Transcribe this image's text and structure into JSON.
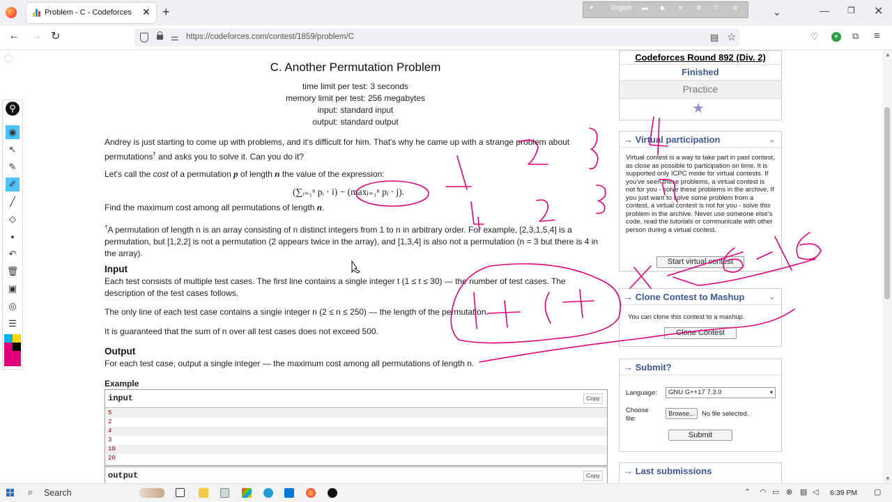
{
  "browser": {
    "tab_title": "Problem - C - Codeforces",
    "tab_close": "✕",
    "new_tab": "+",
    "tab_list": "⌄",
    "url": "https://codeforces.com/contest/1859/problem/C",
    "overlay_label": "English",
    "window": {
      "minimize": "—",
      "maximize": "❐",
      "close": "✕"
    }
  },
  "problem": {
    "title": "C. Another Permutation Problem",
    "time_limit": "time limit per test: 3 seconds",
    "memory_limit": "memory limit per test: 256 megabytes",
    "input": "input: standard input",
    "output": "output: standard output",
    "statement_1": "Andrey is just starting to come up with problems, and it's difficult for him. That's why he came up with a strange problem about permutations",
    "statement_1_end": " and asks you to solve it. Can you do it?",
    "cost_intro_a": "Let's call the ",
    "cost_word": "cost",
    "cost_intro_b": " of a permutation ",
    "cost_intro_c": " of length ",
    "cost_intro_d": " the value of the expression:",
    "formula": "(∑ᵢ₌₁ⁿ pᵢ · i) − (maxⱼ₌₁ⁿ pⱼ · j).",
    "find_max": "Find the maximum cost among all permutations of length ",
    "footnote": "A permutation of length n is an array consisting of n distinct integers from 1 to n in arbitrary order. For example, [2,3,1,5,4] is a permutation, but [1,2,2] is not a permutation (2 appears twice in the array), and [1,3,4] is also not a permutation (n = 3 but there is 4 in the array).",
    "input_title": "Input",
    "input_text_1": "Each test consists of multiple test cases. The first line contains a single integer t (1 ≤ t ≤ 30) — the number of test cases. The description of the test cases follows.",
    "input_text_2": "The only line of each test case contains a single integer n (2 ≤ n ≤ 250) — the length of the permutation.",
    "input_text_3": "It is guaranteed that the sum of n over all test cases does not exceed 500.",
    "output_title": "Output",
    "output_text": "For each test case, output a single integer — the maximum cost among all permutations of length n.",
    "example_label": "Example",
    "input_box_label": "input",
    "output_box_label": "output",
    "copy_label": "Copy",
    "example_input": [
      "5",
      "2",
      "4",
      "3",
      "10",
      "20"
    ],
    "var_p": "p",
    "var_n": "n",
    "dagger": "†",
    "period": "."
  },
  "sidebar": {
    "contest_name": "Codeforces Round 892 (Div. 2)",
    "status": "Finished",
    "practice": "Practice",
    "virtual_title": "→ Virtual participation",
    "virtual_text": "Virtual contest is a way to take part in past contest, as close as possible to participation on time. It is supported only ICPC mode for virtual contests. If you've seen these problems, a virtual contest is not for you - solve these problems in the archive. If you just want to solve some problem from a contest, a virtual contest is not for you - solve this problem in the archive. Never use someone else's code, read the tutorials or communicate with other person during a virtual contest.",
    "start_virtual": "Start virtual contest",
    "clone_title": "→ Clone Contest to Mashup",
    "clone_text": "You can clone this contest to a mashup.",
    "clone_button": "Clone Contest",
    "submit_title": "→ Submit?",
    "language_label": "Language:",
    "language_value": "GNU G++17 7.3.0",
    "choose_file_label": "Choose file:",
    "browse_button": "Browse...",
    "no_file": "No file selected.",
    "submit_button": "Submit",
    "last_submissions_title": "→ Last submissions"
  },
  "taskbar": {
    "search_label": "Search",
    "time": "6:39 PM"
  },
  "colors": {
    "link_blue": "#3b5998",
    "ink_pink": "#e0007a",
    "selection_blue": "#4cc3ff"
  }
}
